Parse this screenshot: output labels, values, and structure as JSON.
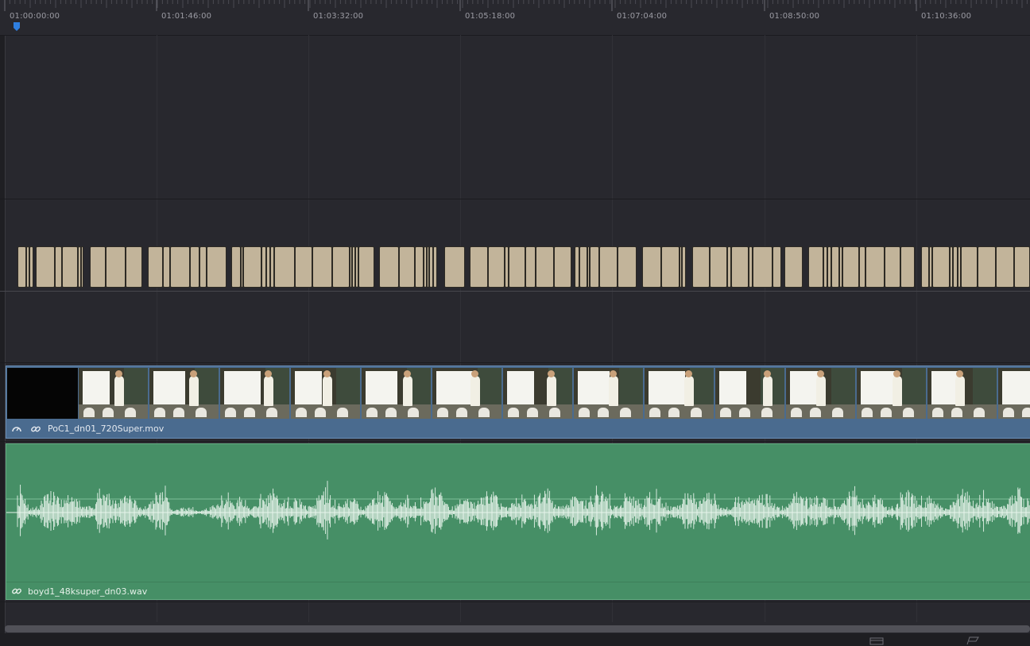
{
  "ruler": {
    "timecodes": [
      "01:00:00:00",
      "01:01:46:00",
      "01:03:32:00",
      "01:05:18:00",
      "01:07:04:00",
      "01:08:50:00",
      "01:10:36:00"
    ]
  },
  "playhead": {
    "icon": "playhead-marker-icon",
    "color": "#2f7fe0"
  },
  "video_track": {
    "clip_name": "PoC1_dn01_720Super.mov",
    "icons": [
      "speed-change-icon",
      "link-icon"
    ],
    "color": "#4a6b8f"
  },
  "subtitle_track": {
    "color": "#c2b49a"
  },
  "audio_track": {
    "clip_name": "boyd1_48ksuper_dn03.wav",
    "icons": [
      "link-icon"
    ],
    "color": "#468f66"
  },
  "bottom_bar": {
    "icons": [
      "track-height-icon",
      "flag-icon"
    ]
  }
}
